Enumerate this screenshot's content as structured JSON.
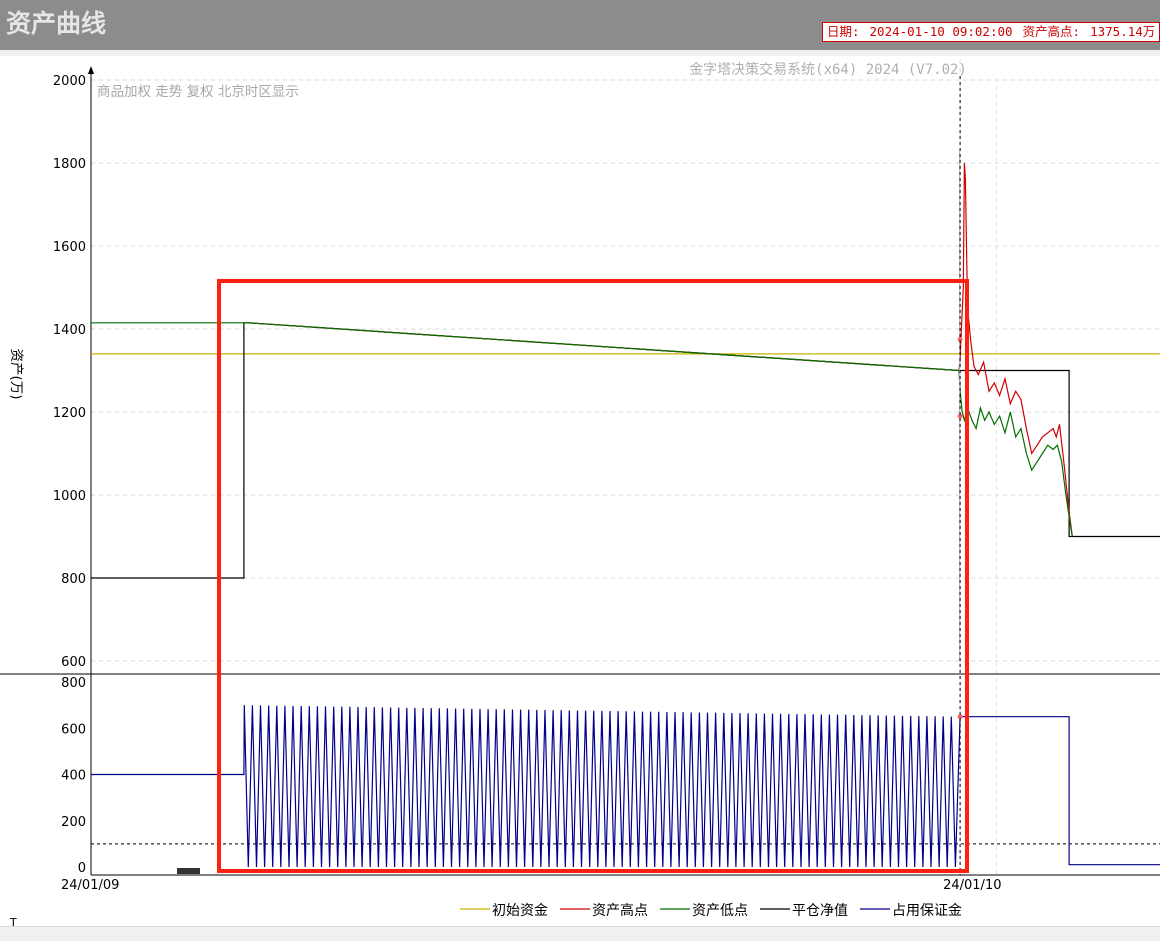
{
  "window": {
    "title": "资产曲线"
  },
  "info": {
    "date_label": "日期:",
    "date_value": "2024-01-10 09:02:00",
    "high_label": "资产高点:",
    "high_value": "1375.14万"
  },
  "chart_data": [
    {
      "type": "line",
      "watermark": "金字塔决策交易系统(x64) 2024 (V7.02)",
      "subtitle": "商品加权 走势 复权 北京时区显示",
      "ylabel": "资产(万)",
      "ylim": [
        600,
        2000
      ],
      "yticks": [
        600,
        800,
        1000,
        1200,
        1400,
        1600,
        1800,
        2000
      ],
      "x_labels": [
        {
          "label": "24/01/09",
          "x": 0.0
        },
        {
          "label": "24/01/10",
          "x": 81.3
        }
      ],
      "xlim": [
        0,
        100
      ],
      "initial_capital": 1340,
      "series": [
        {
          "name": "平仓净值",
          "color": "#000000",
          "points": [
            [
              0,
              800
            ],
            [
              14.3,
              800
            ],
            [
              14.3,
              1415
            ],
            [
              14.7,
              1415
            ],
            [
              81.2,
              1300
            ],
            [
              91.5,
              1300
            ],
            [
              91.5,
              900
            ],
            [
              100,
              900
            ]
          ]
        },
        {
          "name": "资产高点",
          "color": "#d00000",
          "points": [
            [
              14.7,
              1415
            ],
            [
              81.2,
              1300
            ],
            [
              81.3,
              1330
            ],
            [
              81.6,
              1500
            ],
            [
              81.7,
              1800
            ],
            [
              81.8,
              1760
            ],
            [
              81.9,
              1600
            ],
            [
              82.0,
              1450
            ],
            [
              82.3,
              1370
            ],
            [
              82.6,
              1310
            ],
            [
              83.0,
              1290
            ],
            [
              83.5,
              1320
            ],
            [
              84.0,
              1250
            ],
            [
              84.5,
              1270
            ],
            [
              85.0,
              1240
            ],
            [
              85.5,
              1280
            ],
            [
              86.0,
              1220
            ],
            [
              86.5,
              1250
            ],
            [
              87.0,
              1230
            ],
            [
              87.5,
              1160
            ],
            [
              88.0,
              1100
            ],
            [
              88.5,
              1120
            ],
            [
              89.0,
              1140
            ],
            [
              89.5,
              1150
            ],
            [
              90.0,
              1160
            ],
            [
              90.3,
              1140
            ],
            [
              90.6,
              1170
            ],
            [
              91.0,
              1080
            ],
            [
              91.5,
              960
            ],
            [
              91.8,
              900
            ]
          ]
        },
        {
          "name": "资产低点",
          "color": "#007000",
          "points": [
            [
              0,
              1415
            ],
            [
              14.7,
              1415
            ],
            [
              81.2,
              1300
            ],
            [
              81.3,
              1250
            ],
            [
              81.5,
              1200
            ],
            [
              81.7,
              1180
            ],
            [
              82.0,
              1210
            ],
            [
              82.4,
              1180
            ],
            [
              82.8,
              1160
            ],
            [
              83.2,
              1210
            ],
            [
              83.6,
              1180
            ],
            [
              84.0,
              1200
            ],
            [
              84.5,
              1170
            ],
            [
              85.0,
              1190
            ],
            [
              85.5,
              1150
            ],
            [
              86.0,
              1200
            ],
            [
              86.5,
              1140
            ],
            [
              87.0,
              1160
            ],
            [
              87.5,
              1100
            ],
            [
              88.0,
              1060
            ],
            [
              88.5,
              1080
            ],
            [
              89.0,
              1100
            ],
            [
              89.5,
              1120
            ],
            [
              90.0,
              1110
            ],
            [
              90.4,
              1120
            ],
            [
              90.8,
              1080
            ],
            [
              91.2,
              1000
            ],
            [
              91.6,
              930
            ],
            [
              91.8,
              900
            ]
          ]
        }
      ]
    },
    {
      "type": "line",
      "ylim": [
        -30,
        830
      ],
      "yticks": [
        0,
        200,
        400,
        600,
        800
      ],
      "xlim": [
        0,
        100
      ],
      "reference_line": 100,
      "series": [
        {
          "name": "占用保证金",
          "color": "#00008b",
          "start": [
            [
              0,
              400
            ],
            [
              14.3,
              400
            ]
          ],
          "oscillation": {
            "x_start": 14.3,
            "x_end": 81.2,
            "cycles": 88,
            "high_start": 700,
            "high_end": 650,
            "low": 0
          },
          "end": [
            [
              81.3,
              650
            ],
            [
              91.5,
              650
            ],
            [
              91.5,
              10
            ],
            [
              100,
              10
            ]
          ]
        }
      ]
    }
  ],
  "legend": [
    {
      "name": "初始资金",
      "color": "#c8b400"
    },
    {
      "name": "资产高点",
      "color": "#d00000"
    },
    {
      "name": "资产低点",
      "color": "#007000"
    },
    {
      "name": "平仓净值",
      "color": "#000000"
    },
    {
      "name": "占用保证金",
      "color": "#00008b"
    }
  ],
  "overlay": {
    "color": "#ff2010"
  }
}
